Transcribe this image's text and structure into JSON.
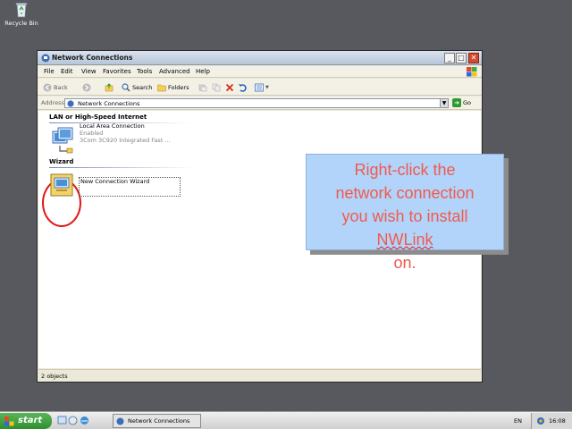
{
  "desktop": {
    "recycle_bin_label": "Recycle Bin"
  },
  "window": {
    "title": "Network Connections",
    "controls": {
      "minimize": "_",
      "maximize": "□",
      "close": "✕"
    }
  },
  "menu": {
    "items": [
      "File",
      "Edit",
      "View",
      "Favorites",
      "Tools",
      "Advanced",
      "Help"
    ]
  },
  "toolbar": {
    "back_label": "Back",
    "search_label": "Search",
    "folders_label": "Folders"
  },
  "address": {
    "label": "Address",
    "value": "Network Connections",
    "go_label": "Go"
  },
  "content": {
    "group_lan": "LAN or High-Speed Internet",
    "group_wizard": "Wizard",
    "lan_item": {
      "name": "Local Area Connection",
      "status": "Enabled",
      "device": "3Com 3C920 Integrated Fast ..."
    },
    "wizard_item": {
      "name": "New Connection Wizard"
    }
  },
  "status_bar": {
    "text": "2 objects"
  },
  "callout": {
    "line1": "Right-click the",
    "line2": "network connection",
    "line3": "you wish to install",
    "line4_word": "NWLink",
    "line4_rest": " on."
  },
  "taskbar": {
    "start_label": "start",
    "task_label": "Network Connections",
    "language": "EN",
    "clock": "16:08"
  },
  "colors": {
    "desktop": "#58585f",
    "callout_bg": "#b3d4fa",
    "callout_text": "#ef5a4e",
    "annotation_circle": "#e31a1a",
    "start_button": "#3a9a3a"
  },
  "icons": [
    "recycle-bin-icon",
    "network-connections-icon",
    "back-icon",
    "forward-icon",
    "up-folder-icon",
    "search-icon",
    "folders-icon",
    "move-to-icon",
    "copy-to-icon",
    "delete-icon",
    "undo-icon",
    "views-icon",
    "lan-connection-icon",
    "wizard-icon",
    "windows-flag-icon",
    "clock-tray-icon"
  ]
}
